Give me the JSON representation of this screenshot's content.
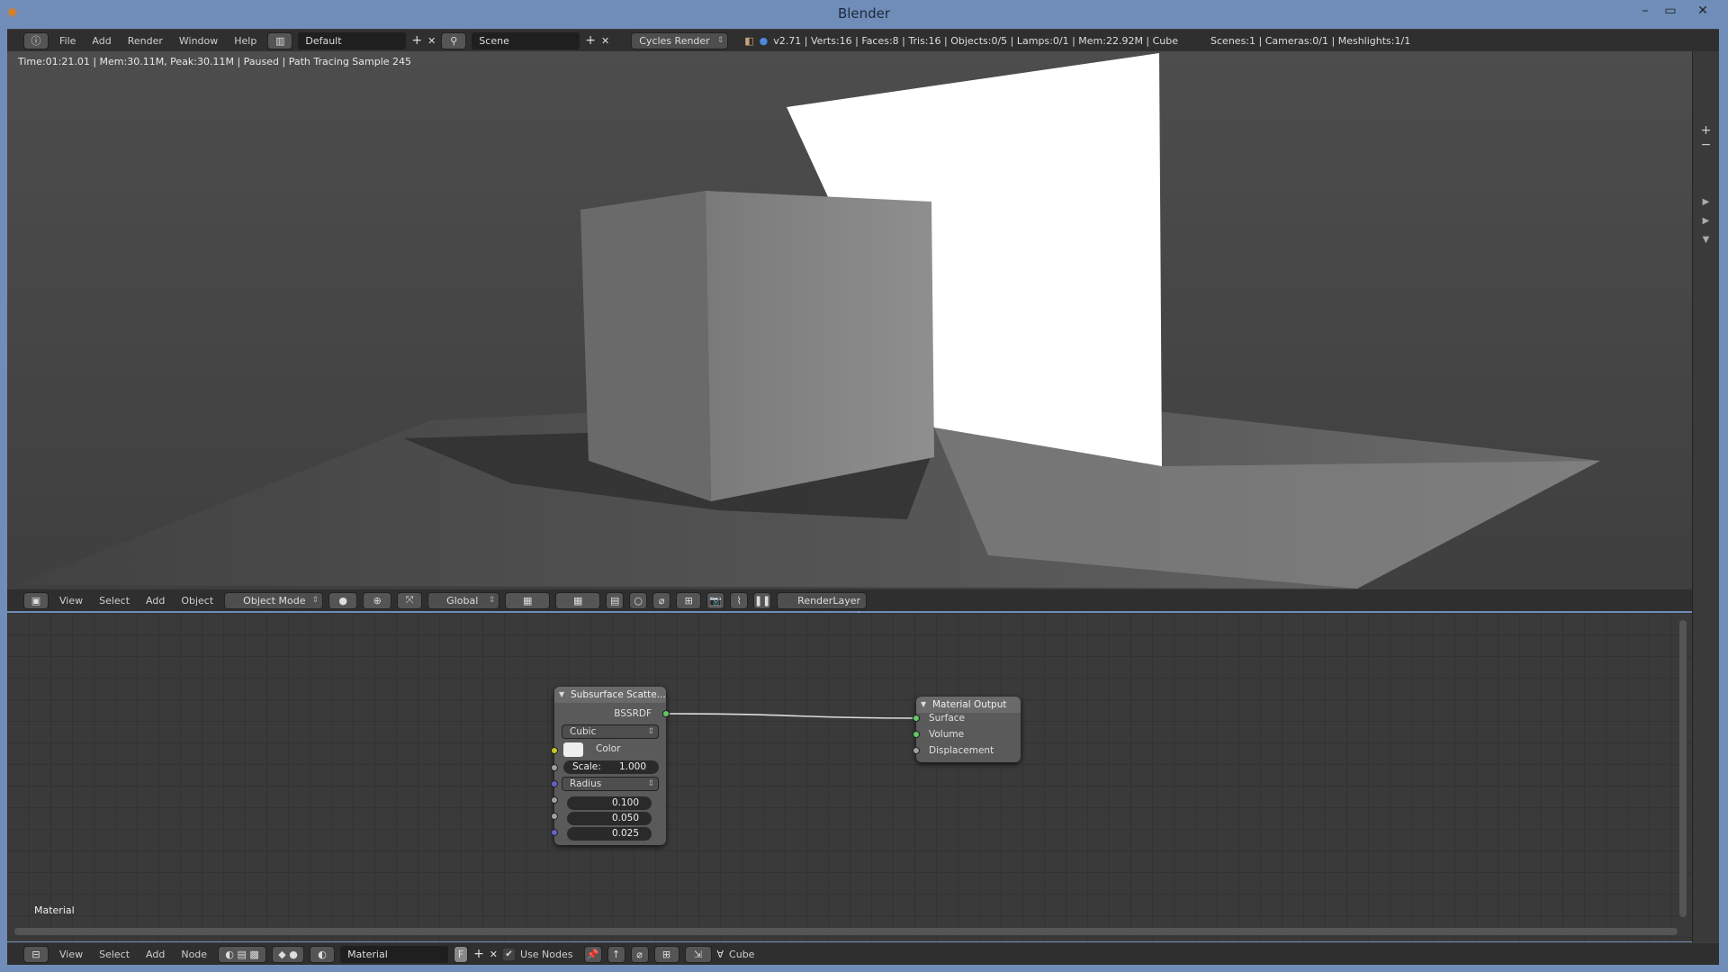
{
  "window": {
    "title": "Blender",
    "minimize": "–",
    "maximize": "▭",
    "close": "✕"
  },
  "info_header": {
    "menus": [
      "File",
      "Add",
      "Render",
      "Window",
      "Help"
    ],
    "layout": "Default",
    "scene": "Scene",
    "engine": "Cycles Render",
    "stats": "v2.71 | Verts:16 | Faces:8 | Tris:16 | Objects:0/5 | Lamps:0/1 | Mem:22.92M | Cube",
    "stats2": "Scenes:1 | Cameras:0/1 | Meshlights:1/1"
  },
  "viewport": {
    "render_info": "Time:01:21.01 | Mem:30.11M, Peak:30.11M | Paused | Path Tracing Sample 245"
  },
  "view3d_header": {
    "menus": [
      "View",
      "Select",
      "Add",
      "Object"
    ],
    "mode": "Object Mode",
    "orientation": "Global",
    "render_layer": "RenderLayer"
  },
  "node_editor": {
    "label": "Material",
    "sss_node": {
      "title": "Subsurface Scatte...",
      "output": "BSSRDF",
      "falloff": "Cubic",
      "color_label": "Color",
      "scale_label": "Scale:",
      "scale_value": "1.000",
      "radius_label": "Radius",
      "radius": [
        "0.100",
        "0.050",
        "0.025"
      ]
    },
    "output_node": {
      "title": "Material Output",
      "inputs": [
        "Surface",
        "Volume",
        "Displacement"
      ]
    },
    "colors": {
      "shader_socket": "#63c763",
      "color_socket": "#c7c729",
      "float_socket": "#a1a1a1",
      "vector_socket": "#6363c7"
    }
  },
  "node_header": {
    "menus": [
      "View",
      "Select",
      "Add",
      "Node"
    ],
    "material": "Material",
    "fake_user": "F",
    "use_nodes": "Use Nodes",
    "object": "Cube"
  }
}
